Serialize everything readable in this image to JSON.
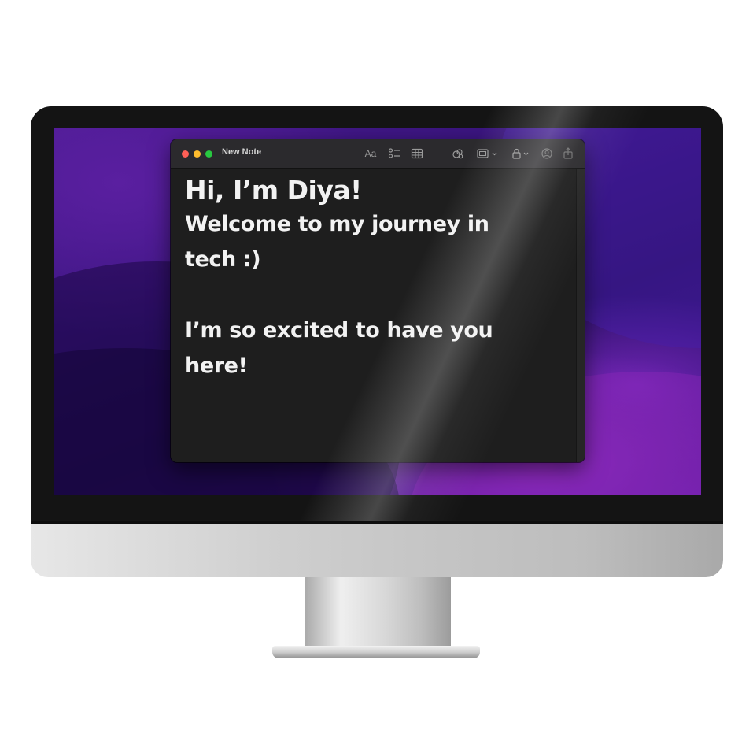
{
  "window": {
    "title": "New Note",
    "toolbar": {
      "format_label": "Aa",
      "icons": [
        "format-icon",
        "checklist-icon",
        "table-icon",
        "collaborate-icon",
        "media-icon",
        "lock-icon",
        "share-person-icon",
        "share-icon"
      ]
    }
  },
  "note": {
    "heading": "Hi, I’m Diya!",
    "line1": "Welcome to my journey in",
    "line2": "tech :)",
    "line3": "I’m so excited to have you",
    "line4": "here!"
  },
  "colors": {
    "traffic_red": "#fe5f57",
    "traffic_yellow": "#febc2e",
    "traffic_green": "#28c840",
    "note_background": "#1e1e1e",
    "wallpaper_purple": "#4b1b93"
  }
}
